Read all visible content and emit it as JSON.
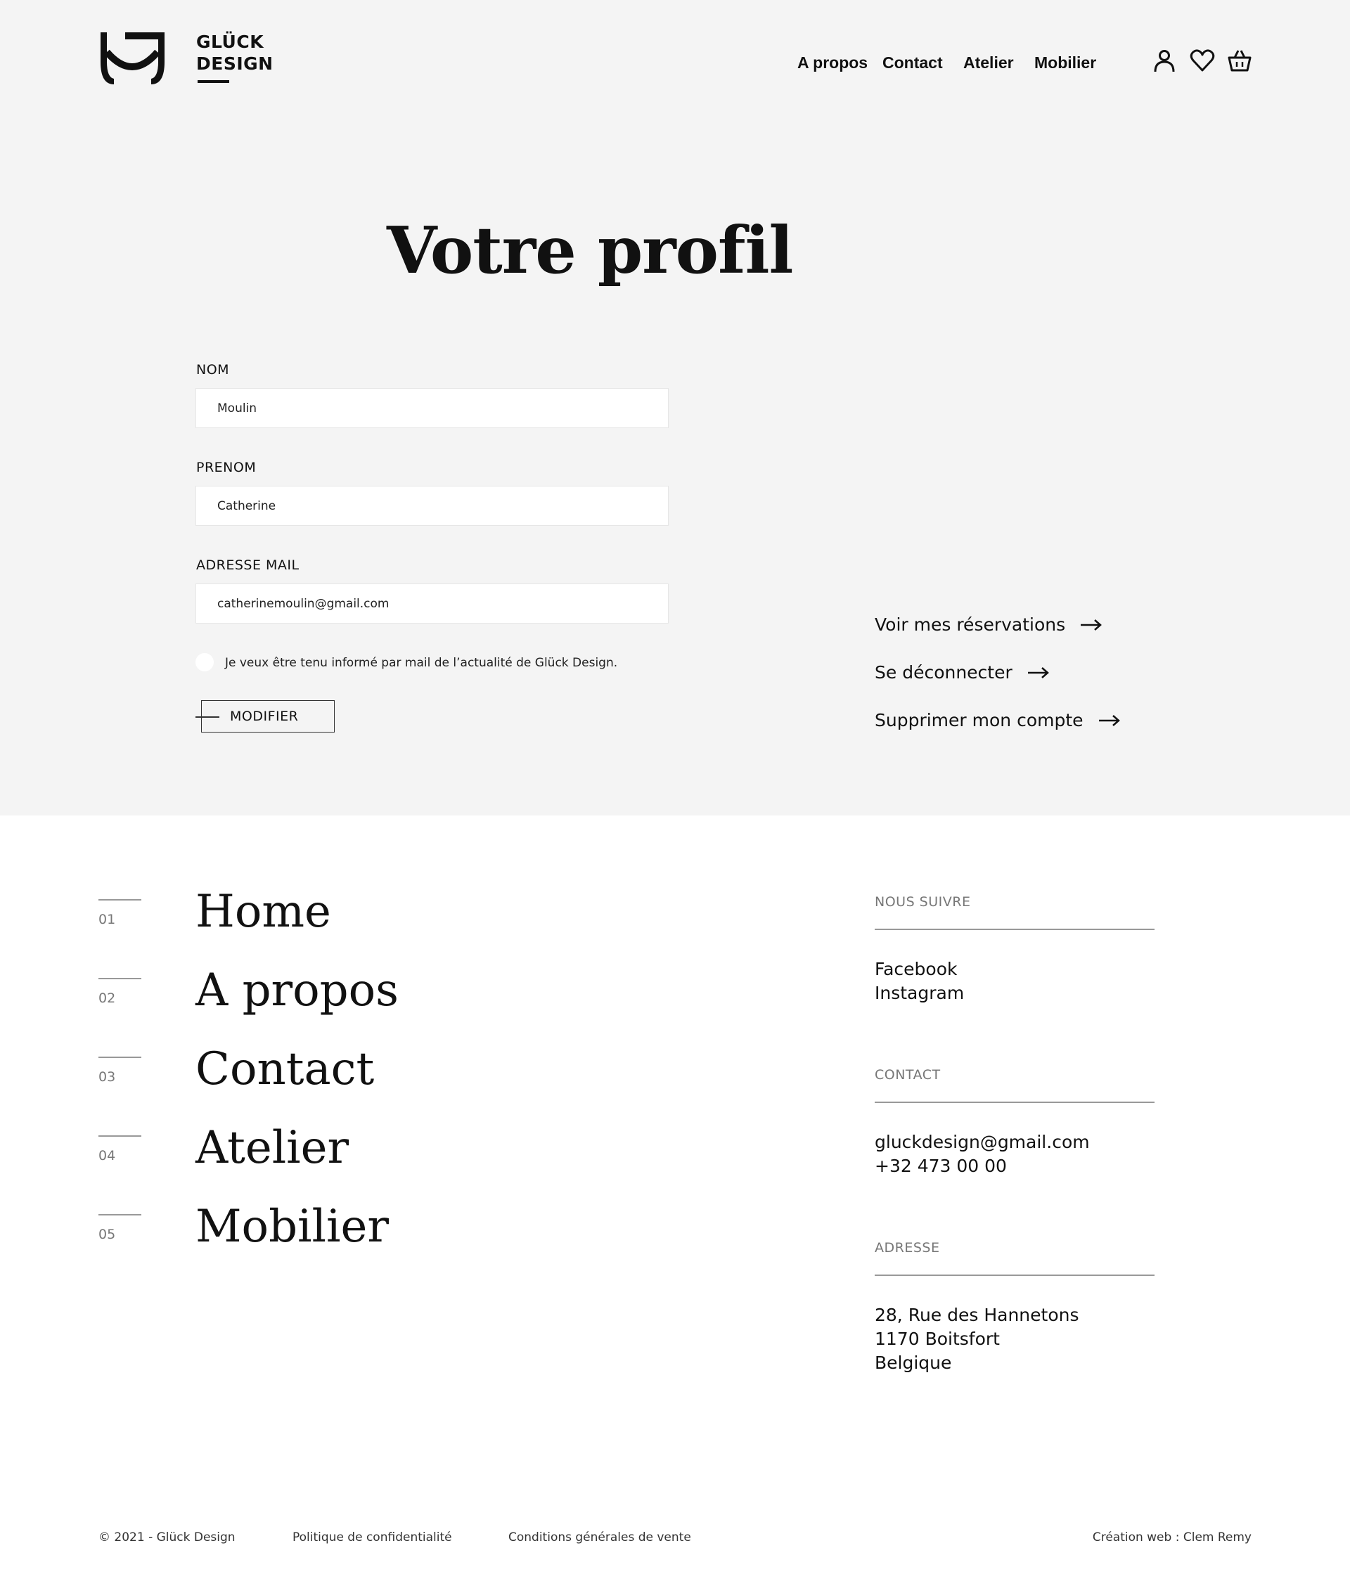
{
  "header": {
    "brand_line1": "GLÜCK",
    "brand_line2": "DESIGN",
    "nav": [
      "A propos",
      "Contact",
      "Atelier",
      "Mobilier"
    ],
    "icons": [
      "user-icon",
      "heart-icon",
      "basket-icon"
    ]
  },
  "profile": {
    "title": "Votre profil",
    "nom_label": "NOM",
    "nom_value": "Moulin",
    "prenom_label": "PRENOM",
    "prenom_value": "Catherine",
    "email_label": "ADRESSE MAIL",
    "email_value": "catherinemoulin@gmail.com",
    "newsletter_label": "Je veux être tenu informé par mail de l’actualité de Glück Design.",
    "modify_label": "MODIFIER"
  },
  "account_links": [
    "Voir mes réservations",
    "Se déconnecter",
    "Supprimer mon compte"
  ],
  "footer": {
    "nav": [
      {
        "num": "01",
        "label": "Home"
      },
      {
        "num": "02",
        "label": "A propos"
      },
      {
        "num": "03",
        "label": "Contact"
      },
      {
        "num": "04",
        "label": "Atelier"
      },
      {
        "num": "05",
        "label": "Mobilier"
      }
    ],
    "follow_head": "NOUS SUIVRE",
    "follow_links": [
      "Facebook",
      "Instagram"
    ],
    "contact_head": "CONTACT",
    "contact_lines": [
      "gluckdesign@gmail.com",
      "+32 473 00 00"
    ],
    "address_head": "ADRESSE",
    "address_lines": [
      "28, Rue des Hannetons",
      "1170 Boitsfort",
      "Belgique"
    ],
    "copyright": "© 2021 - Glück Design",
    "privacy": "Politique de confidentialité",
    "terms": "Conditions générales de vente",
    "credit": "Création web : Clem Remy"
  },
  "colors": {
    "top_background": "#f4f4f4",
    "text": "#111111",
    "muted": "#777777"
  }
}
